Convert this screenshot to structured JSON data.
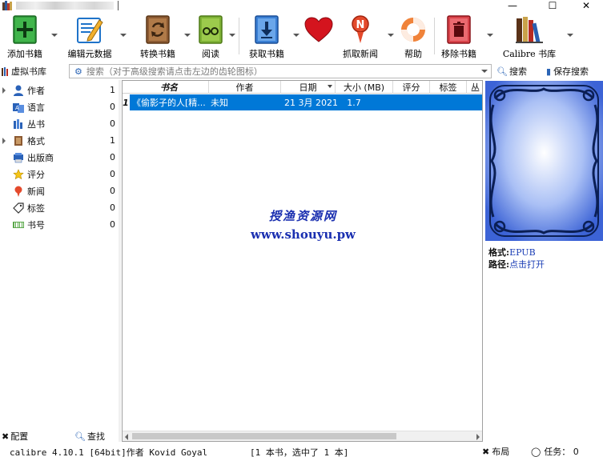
{
  "window": {
    "minimize_glyph": "—",
    "maximize_glyph": "☐",
    "close_glyph": "✕"
  },
  "toolbar": {
    "add_books": "添加书籍",
    "edit_metadata": "编辑元数据",
    "convert_books": "转换书籍",
    "view": "阅读",
    "get_books": "获取书籍",
    "fetch_news": "抓取新闻",
    "help": "帮助",
    "remove_books": "移除书籍",
    "calibre_library": "Calibre 书库",
    "icons": [
      "plus-book-icon",
      "edit-metadata-icon",
      "convert-icon",
      "reader-glasses-icon",
      "download-icon",
      "heart-icon",
      "news-icon",
      "lifebuoy-icon",
      "trash-icon",
      "library-shelf-icon"
    ]
  },
  "search": {
    "virtual_library": "虚拟书库",
    "placeholder": "搜索（对于高级搜索请点击左边的齿轮图标）",
    "search_button": "搜索",
    "saved_searches_button": "保存搜索"
  },
  "tag_browser": {
    "items": [
      {
        "label": "作者",
        "count": "1",
        "expandable": true,
        "icon": "author-icon"
      },
      {
        "label": "语言",
        "count": "0",
        "expandable": false,
        "icon": "language-icon"
      },
      {
        "label": "丛书",
        "count": "0",
        "expandable": false,
        "icon": "series-icon"
      },
      {
        "label": "格式",
        "count": "1",
        "expandable": true,
        "icon": "format-icon"
      },
      {
        "label": "出版商",
        "count": "0",
        "expandable": false,
        "icon": "publisher-icon"
      },
      {
        "label": "评分",
        "count": "0",
        "expandable": false,
        "icon": "rating-star-icon"
      },
      {
        "label": "新闻",
        "count": "0",
        "expandable": false,
        "icon": "news-pin-icon"
      },
      {
        "label": "标签",
        "count": "0",
        "expandable": false,
        "icon": "tag-icon"
      },
      {
        "label": "书号",
        "count": "0",
        "expandable": false,
        "icon": "isbn-icon"
      }
    ],
    "configure_button": "配置",
    "find_button": "查找"
  },
  "book_list": {
    "columns": [
      "书名",
      "作者",
      "日期",
      "大小 (MB)",
      "评分",
      "标签",
      "丛"
    ],
    "rows": [
      {
        "num": "1",
        "title": "《偷影子的人[精...",
        "author": "未知",
        "date": "21 3月 2021",
        "size": "1.7"
      }
    ],
    "watermark_line1": "授渔资源网",
    "watermark_line2": "www.shouyu.pw"
  },
  "book_details": {
    "format_label": "格式:",
    "format_value": "EPUB",
    "path_label": "路径:",
    "path_value": "点击打开"
  },
  "status_bar": {
    "version_text": "calibre 4.10.1 [64bit]作者 Kovid Goyal",
    "selection_text": "[1 本书，选中了 1 本]",
    "layout_label": "布局",
    "jobs_text": "任务： 0"
  },
  "colors": {
    "selection": "#0078d7",
    "watermark": "#1a2fb0",
    "link": "#1a3db5"
  }
}
